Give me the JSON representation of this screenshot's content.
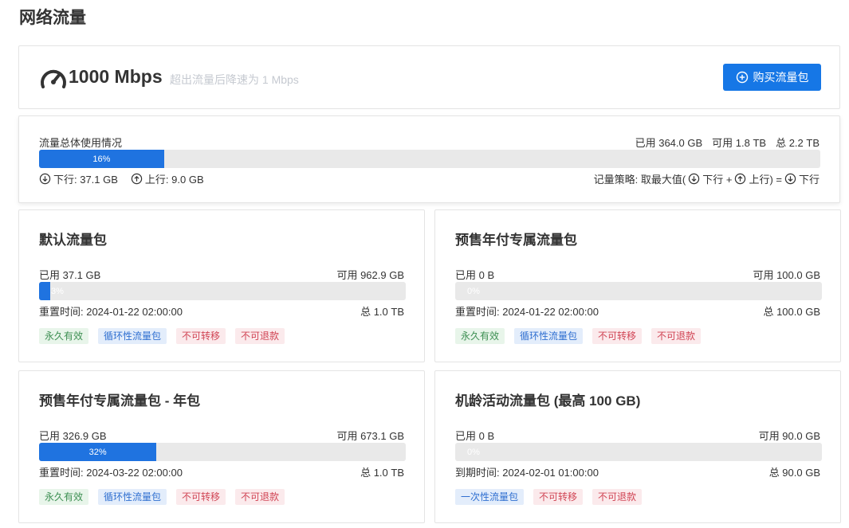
{
  "page": {
    "title": "网络流量"
  },
  "speed": {
    "value": "1000 Mbps",
    "note": "超出流量后降速为 1 Mbps",
    "buy_label": "购买流量包"
  },
  "usage": {
    "label": "流量总体使用情况",
    "used": "已用 364.0 GB",
    "available": "可用 1.8 TB",
    "total": "总 2.2 TB",
    "percent": 16,
    "percent_label": "16%",
    "download": "下行: 37.1 GB",
    "upload": "上行: 9.0 GB",
    "policy_prefix": "记量策略: 取最大值(",
    "policy_down": "下行 +",
    "policy_up": "上行) =",
    "policy_result": "下行"
  },
  "packages": [
    {
      "title": "默认流量包",
      "used": "已用 37.1 GB",
      "available": "可用 962.9 GB",
      "percent": 3,
      "percent_label": "3%",
      "reset": "重置时间: 2024-01-22 02:00:00",
      "total": "总 1.0 TB",
      "tags": [
        {
          "label": "永久有效",
          "color": "green"
        },
        {
          "label": "循环性流量包",
          "color": "blue"
        },
        {
          "label": "不可转移",
          "color": "red"
        },
        {
          "label": "不可退款",
          "color": "red"
        }
      ]
    },
    {
      "title": "预售年付专属流量包",
      "used": "已用 0 B",
      "available": "可用 100.0 GB",
      "percent": 0,
      "percent_label": "0%",
      "reset": "重置时间: 2024-01-22 02:00:00",
      "total": "总 100.0 GB",
      "tags": [
        {
          "label": "永久有效",
          "color": "green"
        },
        {
          "label": "循环性流量包",
          "color": "blue"
        },
        {
          "label": "不可转移",
          "color": "red"
        },
        {
          "label": "不可退款",
          "color": "red"
        }
      ]
    },
    {
      "title": "预售年付专属流量包 - 年包",
      "used": "已用 326.9 GB",
      "available": "可用 673.1 GB",
      "percent": 32,
      "percent_label": "32%",
      "reset": "重置时间: 2024-03-22 02:00:00",
      "total": "总 1.0 TB",
      "tags": [
        {
          "label": "永久有效",
          "color": "green"
        },
        {
          "label": "循环性流量包",
          "color": "blue"
        },
        {
          "label": "不可转移",
          "color": "red"
        },
        {
          "label": "不可退款",
          "color": "red"
        }
      ]
    },
    {
      "title": "机龄活动流量包 (最高 100 GB)",
      "used": "已用 0 B",
      "available": "可用 90.0 GB",
      "percent": 0,
      "percent_label": "0%",
      "reset": "到期时间: 2024-02-01 01:00:00",
      "total": "总 90.0 GB",
      "tags": [
        {
          "label": "一次性流量包",
          "color": "blue"
        },
        {
          "label": "不可转移",
          "color": "red"
        },
        {
          "label": "不可退款",
          "color": "red"
        }
      ]
    }
  ],
  "colors": {
    "accent": "#1677e6",
    "bar_fill": "#1f73e0",
    "bar_track": "#e9e9e9"
  },
  "icons": {
    "speed": "speedometer-icon",
    "buy": "plus-circle-icon",
    "down": "arrow-down-circle-icon",
    "up": "arrow-up-circle-icon"
  }
}
